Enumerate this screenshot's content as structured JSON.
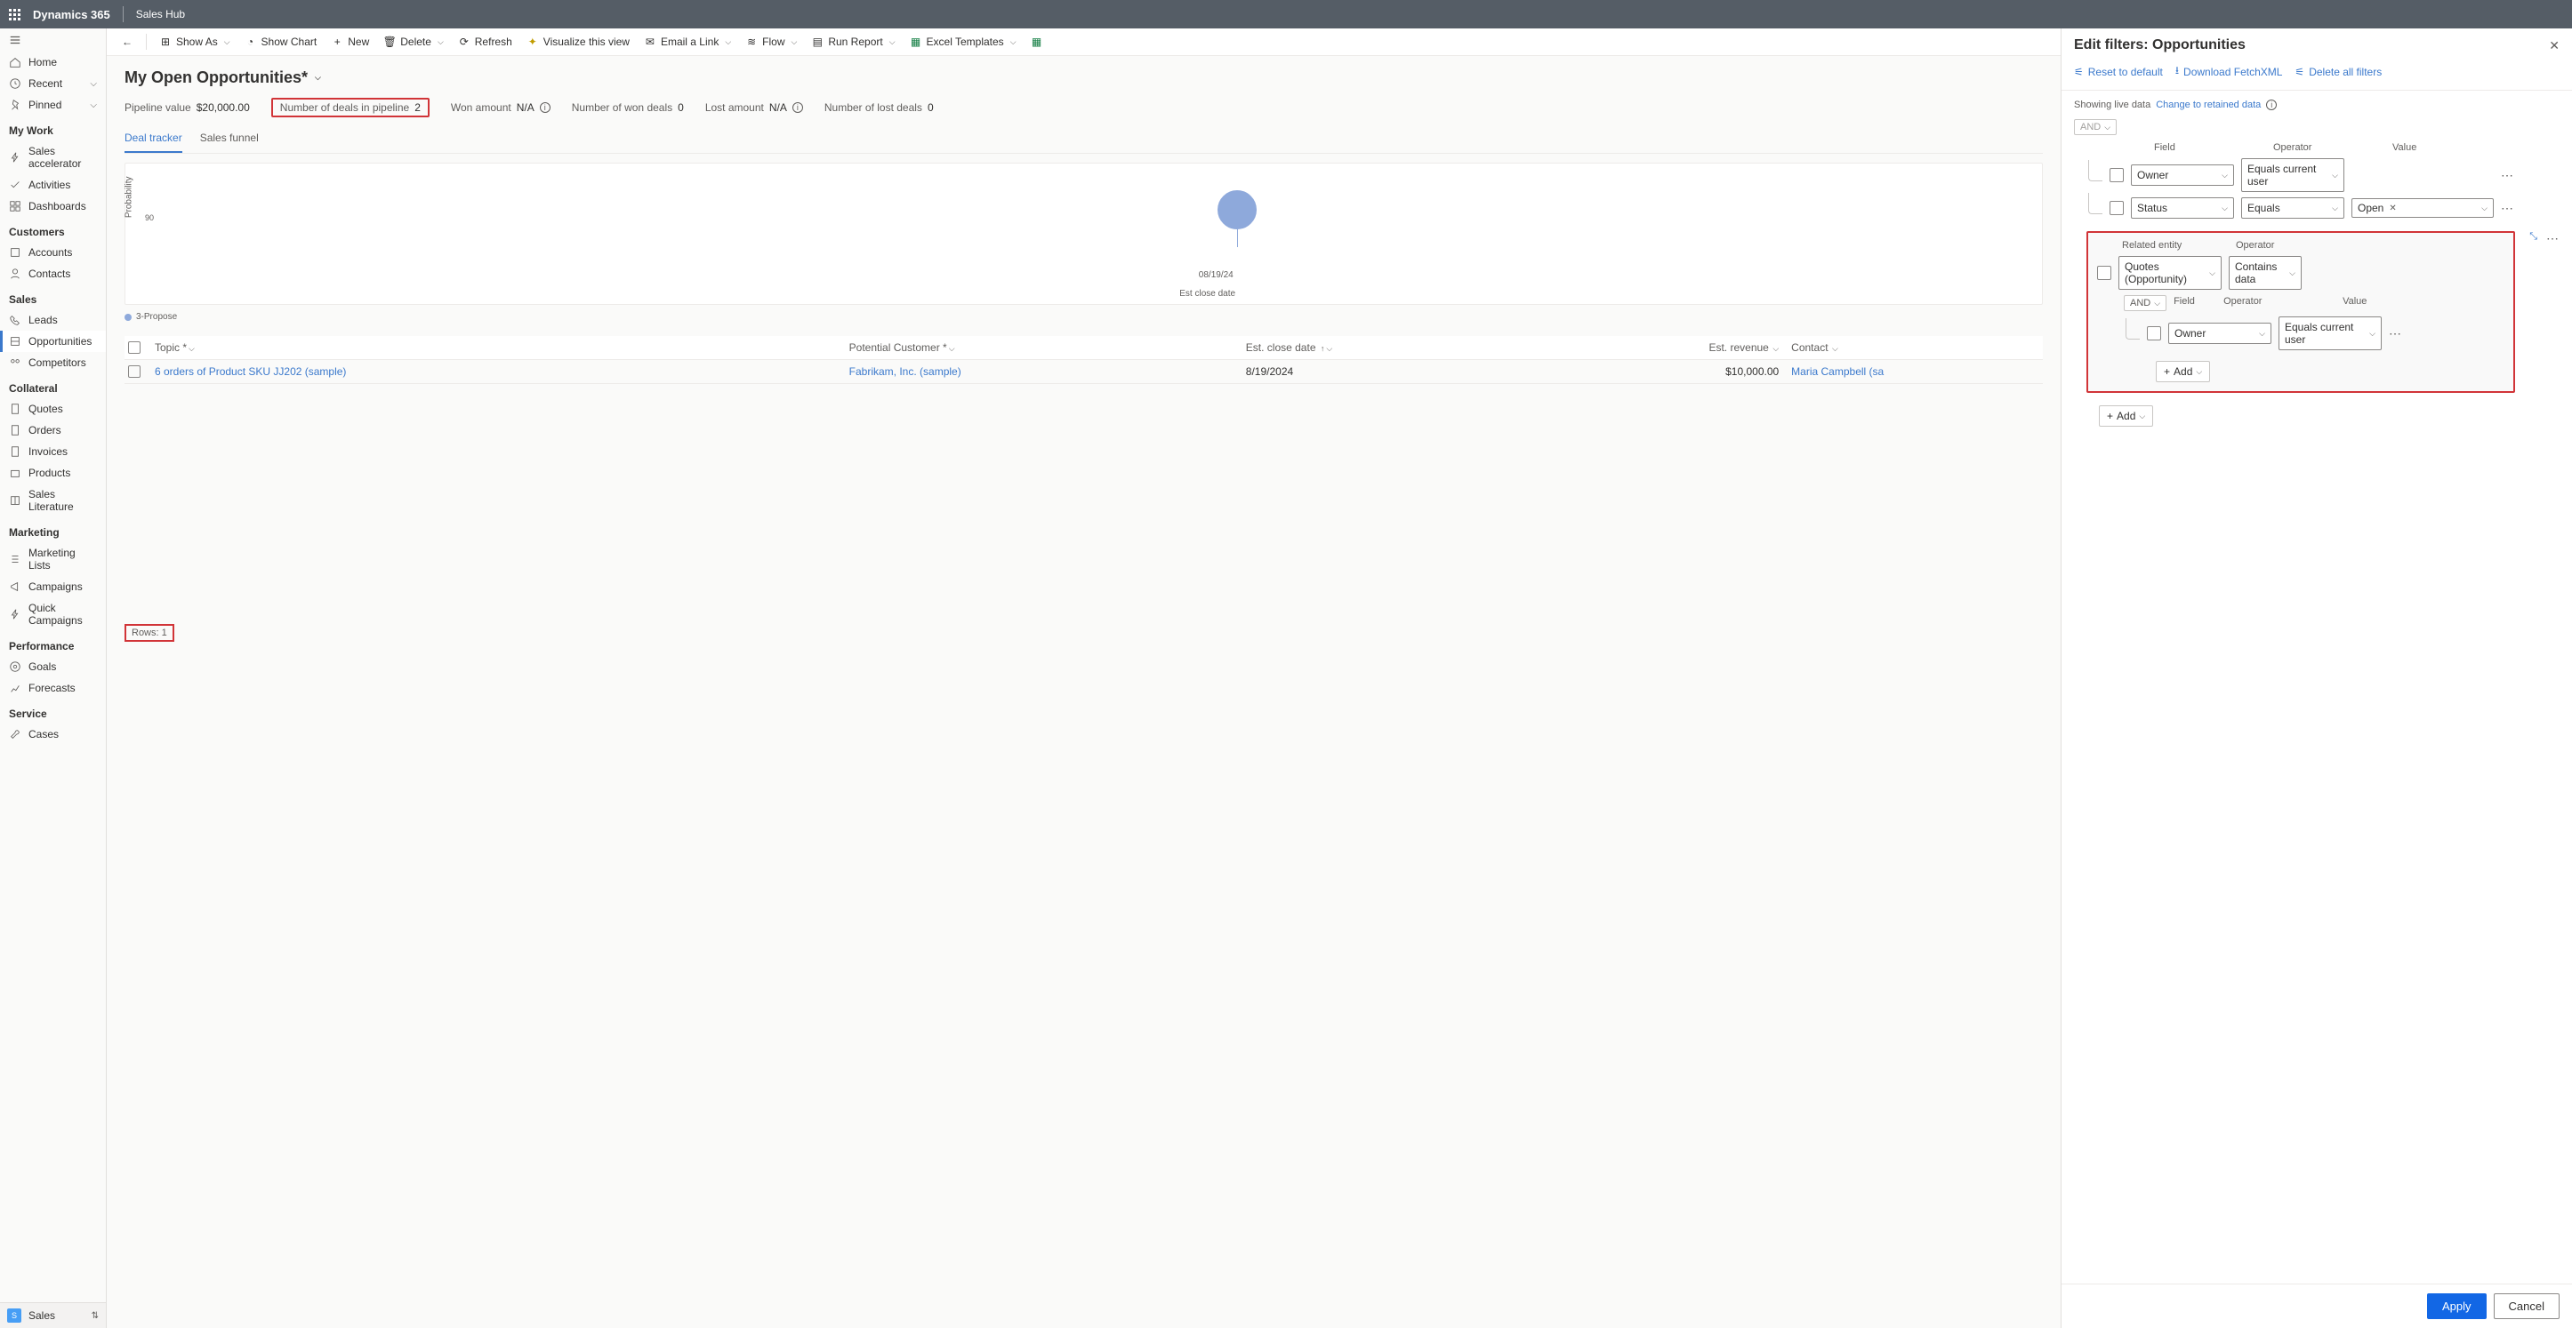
{
  "topbar": {
    "brand": "Dynamics 365",
    "app": "Sales Hub"
  },
  "sidebar": {
    "home": "Home",
    "recent": "Recent",
    "pinned": "Pinned",
    "groups": {
      "mywork": "My Work",
      "customers": "Customers",
      "sales": "Sales",
      "collateral": "Collateral",
      "marketing": "Marketing",
      "performance": "Performance",
      "service": "Service"
    },
    "items": {
      "salesAccel": "Sales accelerator",
      "activities": "Activities",
      "dashboards": "Dashboards",
      "accounts": "Accounts",
      "contacts": "Contacts",
      "leads": "Leads",
      "opportunities": "Opportunities",
      "competitors": "Competitors",
      "quotes": "Quotes",
      "orders": "Orders",
      "invoices": "Invoices",
      "products": "Products",
      "salesLit": "Sales Literature",
      "marketingLists": "Marketing Lists",
      "campaigns": "Campaigns",
      "quickCampaigns": "Quick Campaigns",
      "goals": "Goals",
      "forecasts": "Forecasts",
      "cases": "Cases"
    },
    "area": "Sales"
  },
  "cmd": {
    "back": "",
    "showAs": "Show As",
    "showChart": "Show Chart",
    "new": "New",
    "delete": "Delete",
    "refresh": "Refresh",
    "visualize": "Visualize this view",
    "email": "Email a Link",
    "flow": "Flow",
    "runReport": "Run Report",
    "excel": "Excel Templates"
  },
  "view": {
    "title": "My Open Opportunities*",
    "metrics": {
      "pipelineLabel": "Pipeline value",
      "pipelineVal": "$20,000.00",
      "dealsLabel": "Number of deals in pipeline",
      "dealsVal": "2",
      "wonAmtLabel": "Won amount",
      "wonAmtVal": "N/A",
      "wonDealsLabel": "Number of won deals",
      "wonDealsVal": "0",
      "lostAmtLabel": "Lost amount",
      "lostAmtVal": "N/A",
      "lostDealsLabel": "Number of lost deals",
      "lostDealsVal": "0"
    },
    "tab1": "Deal tracker",
    "tab2": "Sales funnel",
    "chart": {
      "ylabel": "Probability",
      "ytick": "90",
      "xdate": "08/19/24",
      "xlabel": "Est close date",
      "legend": "3-Propose"
    },
    "cols": {
      "topic": "Topic",
      "customer": "Potential Customer",
      "close": "Est. close date",
      "rev": "Est. revenue",
      "contact": "Contact"
    },
    "row": {
      "topic": "6 orders of Product SKU JJ202 (sample)",
      "customer": "Fabrikam, Inc. (sample)",
      "close": "8/19/2024",
      "rev": "$10,000.00",
      "contact": "Maria Campbell (sa"
    },
    "rowsLabel": "Rows: 1"
  },
  "panel": {
    "title": "Edit filters: Opportunities",
    "reset": "Reset to default",
    "fetch": "Download FetchXML",
    "deleteAll": "Delete all filters",
    "live": "Showing live data",
    "change": "Change to retained data",
    "groupOp": "AND",
    "hdr": {
      "field": "Field",
      "operator": "Operator",
      "value": "Value"
    },
    "c1": {
      "field": "Owner",
      "op": "Equals current user"
    },
    "c2": {
      "field": "Status",
      "op": "Equals",
      "val": "Open"
    },
    "rel": {
      "label": "Related entity",
      "opLabel": "Operator",
      "entity": "Quotes (Opportunity)",
      "op": "Contains data",
      "nested": {
        "groupOp": "AND",
        "field": "Field",
        "operator": "Operator",
        "value": "Value",
        "c": {
          "field": "Owner",
          "op": "Equals current user"
        }
      },
      "add": "Add"
    },
    "add": "Add",
    "apply": "Apply",
    "cancel": "Cancel"
  },
  "chart_data": {
    "type": "scatter",
    "title": "Deal tracker",
    "xlabel": "Est close date",
    "ylabel": "Probability",
    "series": [
      {
        "name": "3-Propose",
        "points": [
          {
            "x": "08/19/24",
            "y": 90
          }
        ]
      }
    ],
    "ylim": [
      0,
      100
    ]
  }
}
